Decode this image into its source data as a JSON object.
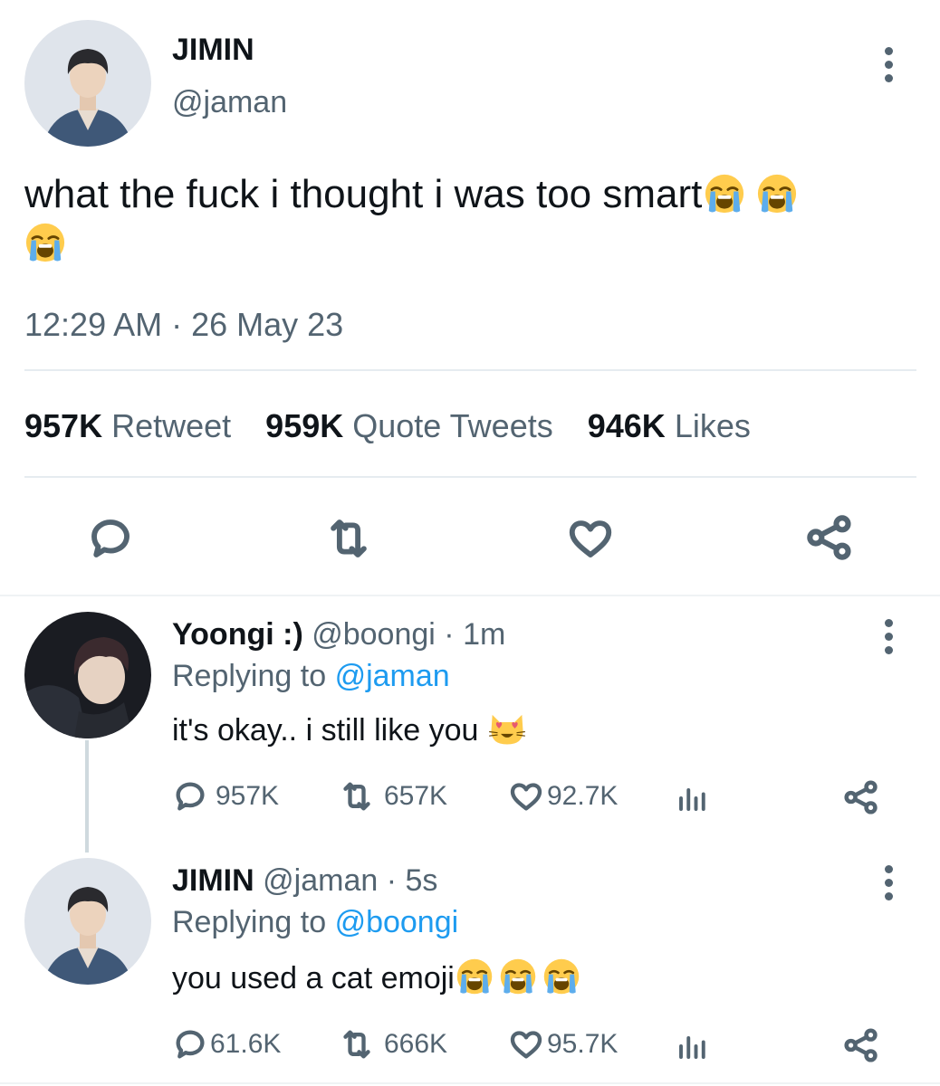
{
  "main_tweet": {
    "name": "JIMIN",
    "handle": "@jaman",
    "text": "what the fuck i thought i was too smart",
    "timestamp": "12:29 AM · 26 May 23",
    "stats": {
      "retweets_count": "957K",
      "retweets_label": "Retweet",
      "quotes_count": "959K",
      "quotes_label": "Quote Tweets",
      "likes_count": "946K",
      "likes_label": "Likes"
    }
  },
  "replies": [
    {
      "name": "Yoongi :)",
      "handle": "@boongi",
      "time": "· 1m",
      "replying_prefix": "Replying to",
      "replying_to": "@jaman",
      "text": "it's okay.. i still like you",
      "replies": "957K",
      "retweets": "657K",
      "likes": "92.7K"
    },
    {
      "name": "JIMIN",
      "handle": "@jaman",
      "time": "· 5s",
      "replying_prefix": "Replying to",
      "replying_to": "@boongi",
      "text": "you used a cat emoji",
      "replies": "61.6K",
      "retweets": "666K",
      "likes": "95.7K"
    }
  ],
  "icons": [
    "more-vertical-icon",
    "reply-icon",
    "retweet-icon",
    "like-icon",
    "share-icon",
    "analytics-icon",
    "loudly-crying-face-emoji",
    "heart-eyes-cat-emoji"
  ],
  "colors": {
    "accent": "#1d9bf0",
    "secondary_text": "#536471",
    "divider": "#e6ecf0"
  }
}
